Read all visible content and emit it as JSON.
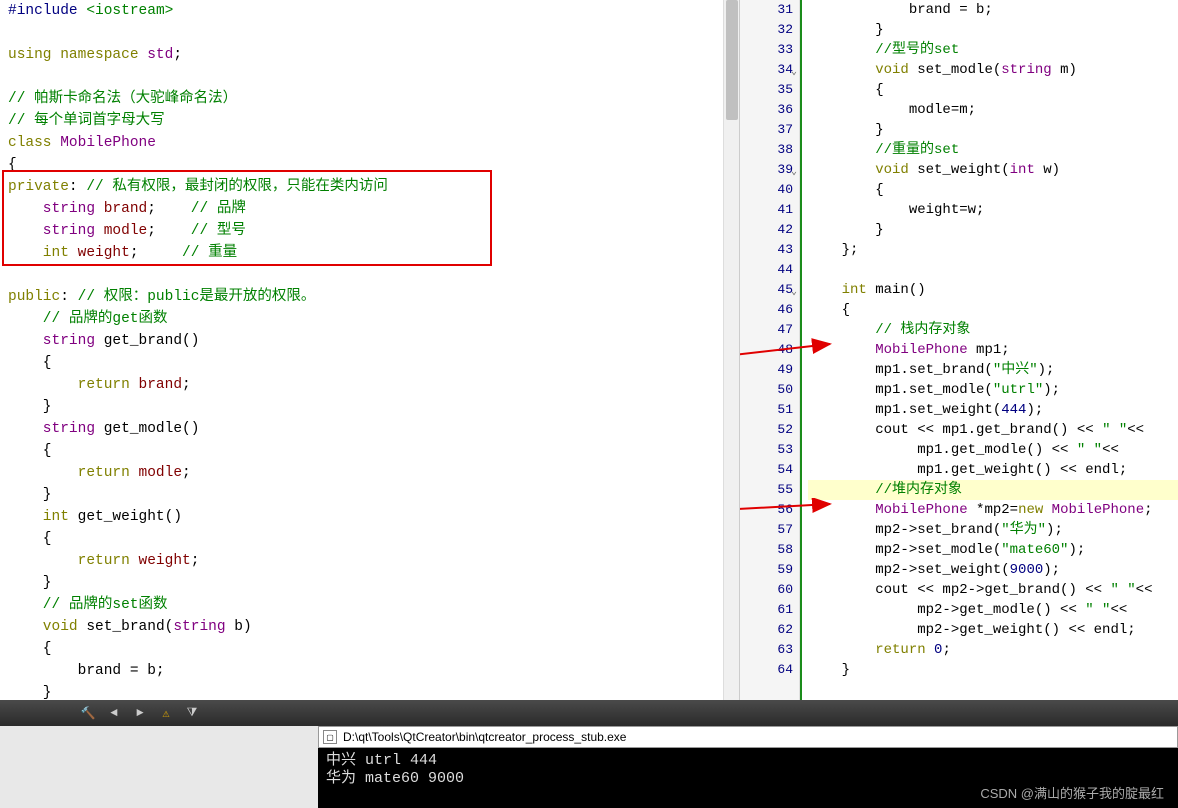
{
  "left": {
    "l1_pre": "#include",
    "l1_inc": " <iostream>",
    "l3_kw": "using",
    "l3_ns": " namespace",
    "l3_std": " std",
    "l3_semi": ";",
    "l5_cmt": "// 帕斯卡命名法（大驼峰命名法）",
    "l6_cmt": "// 每个单词首字母大写",
    "l7_kw": "class",
    "l7_name": " MobilePhone",
    "l8": "{",
    "l9_kw": "private",
    "l9_colon": ":",
    "l9_cmt": " // 私有权限，最封闭的权限，只能在类内访问",
    "l10_type": "    string",
    "l10_id": " brand",
    "l10_semi": ";",
    "l10_cmt": "    // 品牌",
    "l11_type": "    string",
    "l11_id": " modle",
    "l11_semi": ";",
    "l11_cmt": "    // 型号",
    "l12_type": "    int",
    "l12_id": " weight",
    "l12_semi": ";",
    "l12_cmt": "     // 重量",
    "l14_kw": "public",
    "l14_colon": ":",
    "l14_cmt": " // 权限：public是最开放的权限。",
    "l15_cmt": "    // 品牌的get函数",
    "l16_type": "    string",
    "l16_fn": " get_brand()",
    "l17": "    {",
    "l18_kw": "        return",
    "l18_id": " brand",
    "l18_semi": ";",
    "l19": "    }",
    "l20_type": "    string",
    "l20_fn": " get_modle()",
    "l21": "    {",
    "l22_kw": "        return",
    "l22_id": " modle",
    "l22_semi": ";",
    "l23": "    }",
    "l24_type": "    int",
    "l24_fn": " get_weight()",
    "l25": "    {",
    "l26_kw": "        return",
    "l26_id": " weight",
    "l26_semi": ";",
    "l27": "    }",
    "l28_cmt": "    // 品牌的set函数",
    "l29_type": "    void",
    "l29_fn": " set_brand(",
    "l29_ptype": "string",
    "l29_param": " b)",
    "l30": "    {",
    "l31": "        brand = b;",
    "l32": "    }",
    "l33_cmt": "    //型号的set",
    "l34_type": "    void",
    "l34_fn": " set_modle(",
    "l34_ptype": "string",
    "l34_param": " m)"
  },
  "right": {
    "lines": [
      {
        "n": 31,
        "txt": "            brand = b;"
      },
      {
        "n": 32,
        "txt": "        }"
      },
      {
        "n": 33,
        "cmt": "        //型号的set"
      },
      {
        "n": 34,
        "fold": "v",
        "type": "        void",
        "fn": " set_modle(",
        "ptype": "string",
        "param": " m)"
      },
      {
        "n": 35,
        "txt": "        {"
      },
      {
        "n": 36,
        "txt": "            modle=m;"
      },
      {
        "n": 37,
        "txt": "        }"
      },
      {
        "n": 38,
        "cmt": "        //重量的set"
      },
      {
        "n": 39,
        "fold": "v",
        "type": "        void",
        "fn": " set_weight(",
        "ptype": "int",
        "param": " w)"
      },
      {
        "n": 40,
        "txt": "        {"
      },
      {
        "n": 41,
        "txt": "            weight=w;"
      },
      {
        "n": 42,
        "txt": "        }"
      },
      {
        "n": 43,
        "txt": "    };"
      },
      {
        "n": 44,
        "txt": ""
      },
      {
        "n": 45,
        "fold": "v",
        "type": "    int",
        "fn": " main()"
      },
      {
        "n": 46,
        "txt": "    {"
      },
      {
        "n": 47,
        "cmt": "        // 栈内存对象"
      },
      {
        "n": 48,
        "type": "        MobilePhone",
        "id": " mp1;"
      },
      {
        "n": 49,
        "call": "        mp1.set_brand(",
        "str": "\"中兴\"",
        "end": ");"
      },
      {
        "n": 50,
        "call": "        mp1.set_modle(",
        "str": "\"utrl\"",
        "end": ");"
      },
      {
        "n": 51,
        "call": "        mp1.set_weight(",
        "num": "444",
        "end": ");"
      },
      {
        "n": 52,
        "txt": "        cout << mp1.get_brand() << ",
        "str": "\" \"",
        "end2": "<<"
      },
      {
        "n": 53,
        "txt": "             mp1.get_modle() << ",
        "str": "\" \"",
        "end2": "<<"
      },
      {
        "n": 54,
        "txt": "             mp1.get_weight() << endl;"
      },
      {
        "n": 55,
        "hl": true,
        "cmt": "        //堆内存对象"
      },
      {
        "n": 56,
        "type": "        MobilePhone",
        "ptr": " *mp2=",
        "kw": "new",
        "type2": " MobilePhone",
        "end": ";"
      },
      {
        "n": 57,
        "call": "        mp2->set_brand(",
        "str": "\"华为\"",
        "end": ");"
      },
      {
        "n": 58,
        "call": "        mp2->set_modle(",
        "str": "\"mate60\"",
        "end": ");"
      },
      {
        "n": 59,
        "call": "        mp2->set_weight(",
        "num": "9000",
        "end": ");"
      },
      {
        "n": 60,
        "txt": "        cout << mp2->get_brand() << ",
        "str": "\" \"",
        "end2": "<<"
      },
      {
        "n": 61,
        "txt": "             mp2->get_modle() << ",
        "str": "\" \"",
        "end2": "<<"
      },
      {
        "n": 62,
        "txt": "             mp2->get_weight() << endl;"
      },
      {
        "n": 63,
        "kw": "        return",
        "num": " 0",
        "end": ";"
      },
      {
        "n": 64,
        "txt": "    }"
      }
    ]
  },
  "console": {
    "title": "D:\\qt\\Tools\\QtCreator\\bin\\qtcreator_process_stub.exe",
    "out1": "中兴 utrl 444",
    "out2": "华为 mate60 9000"
  },
  "watermark": "CSDN @满山的猴子我的腚最红"
}
